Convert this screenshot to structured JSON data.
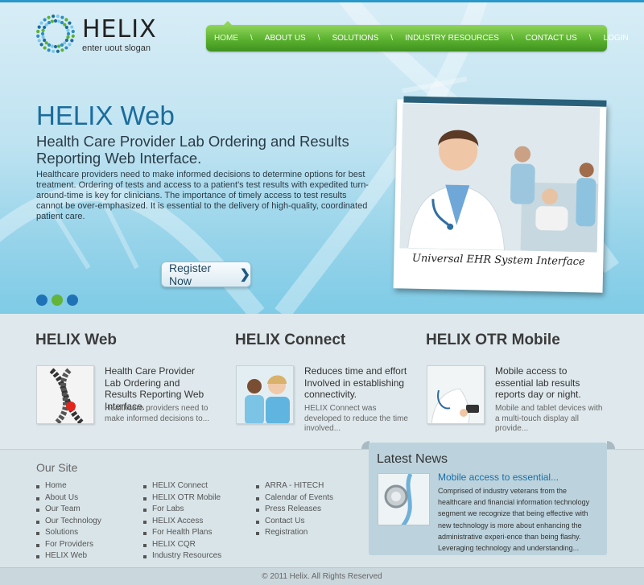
{
  "brand": {
    "name": "HELIX",
    "slogan": "enter uout slogan"
  },
  "nav": {
    "separator": "\\",
    "items": [
      {
        "label": "HOME"
      },
      {
        "label": "ABOUT US"
      },
      {
        "label": "SOLUTIONS"
      },
      {
        "label": "INDUSTRY RESOURCES"
      },
      {
        "label": "CONTACT US"
      },
      {
        "label": "LOGIN"
      }
    ]
  },
  "hero": {
    "title": "HELIX Web",
    "subtitle": "Health Care Provider Lab Ordering and Results Reporting Web Interface.",
    "text": "Healthcare providers need to make informed decisions to determine options for best treatment. Ordering of tests and access to a patient's test results with expedited turn-around-time is key for clinicians. The importance of timely access to test results cannot be over-emphasized. It is essential to the delivery of high-quality, coordinated patient care.",
    "cta": "Register Now",
    "cta_icon": "chevron-right-icon",
    "slider_dots": [
      "#1f72b6",
      "#62b43a",
      "#1f72b6"
    ],
    "photo_caption": "Universal EHR System Interface"
  },
  "features": [
    {
      "title": "HELIX Web",
      "lead": "Health Care Provider Lab Ordering and Results Reporting Web Interface.",
      "desc": "Healthcare providers need to make informed decisions to..."
    },
    {
      "title": "HELIX Connect",
      "lead": "Reduces time and effort Involved in establishing connectivity.",
      "desc": "HELIX Connect was developed to reduce the time involved..."
    },
    {
      "title": "HELIX OTR Mobile",
      "lead": "Mobile access to essential lab results reports day or night.",
      "desc": "Mobile and tablet devices with a multi-touch display all provide..."
    }
  ],
  "footer": {
    "heading": "Our Site",
    "col1": [
      "Home",
      "About Us",
      "Our Team",
      "Our Technology",
      "Solutions",
      "For Providers",
      "HELIX Web"
    ],
    "col2": [
      "HELIX Connect",
      "HELIX OTR Mobile",
      "For Labs",
      "HELIX Access",
      "For Health Plans",
      "HELIX CQR",
      "Industry Resources"
    ],
    "col3": [
      "ARRA  - HITECH",
      "Calendar of Events",
      "Press Releases",
      "Contact Us",
      "Registration"
    ]
  },
  "news": {
    "heading": "Latest News",
    "title": "Mobile access to essential...",
    "text": "Comprised of industry veterans from the healthcare and financial information technology segment we recognize that being effective with new technology is more about enhancing the administrative experi-ence than being flashy.  Leveraging technology and understanding..."
  },
  "copyright": "© 2011 Helix. All Rights Reserved",
  "colors": {
    "accent": "#1b6c9c",
    "nav_green": "#5bb22f",
    "link": "#1a6ea6"
  }
}
